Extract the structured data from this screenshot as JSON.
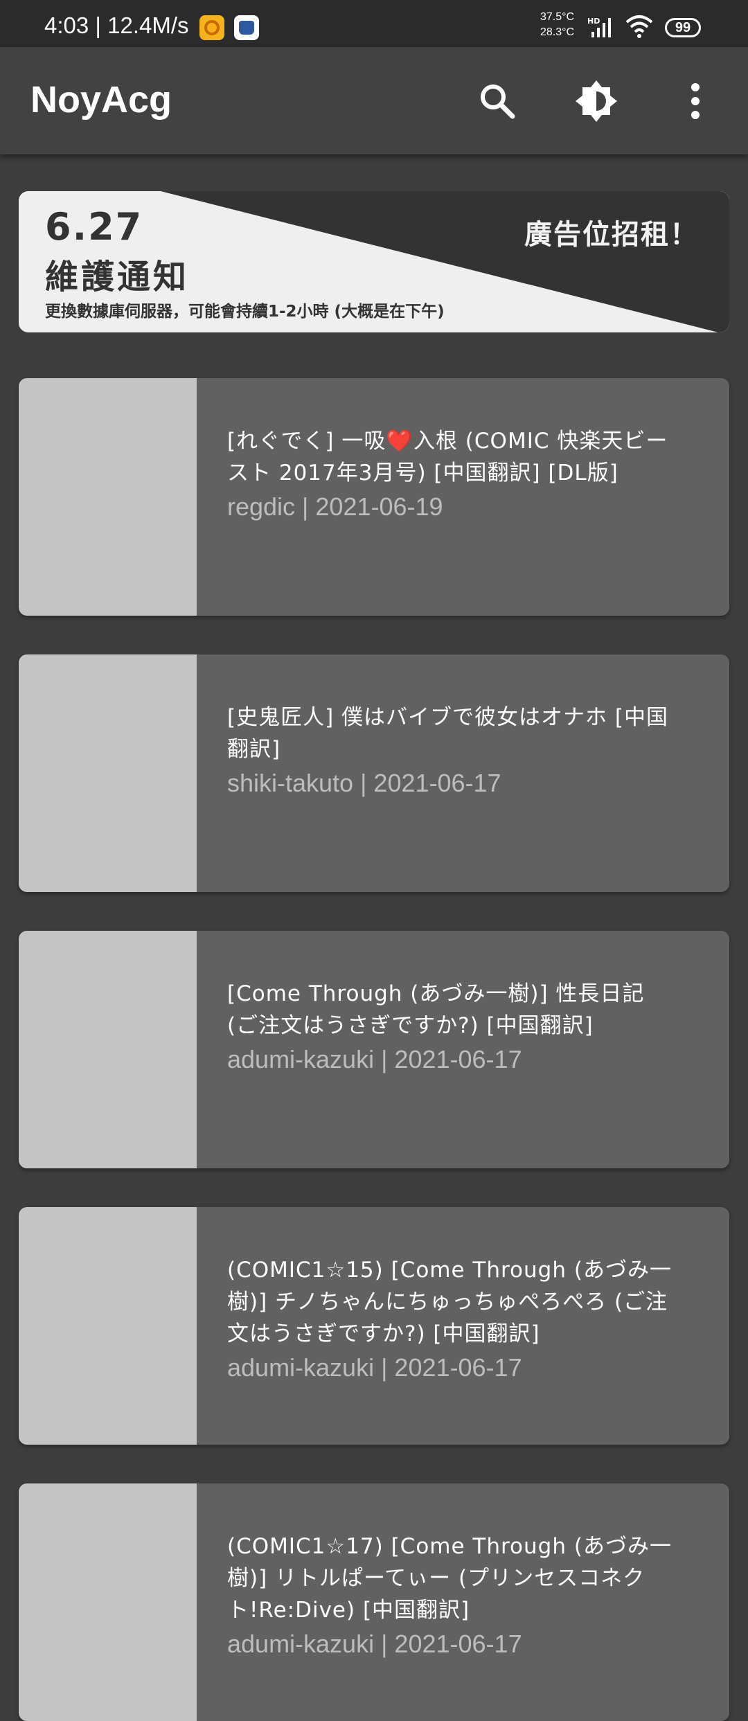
{
  "status_bar": {
    "time_speed": "4:03 | 12.4M/s",
    "temp_top": "37.5°C",
    "temp_bottom": "28.3°C",
    "hd": "HD",
    "battery": "99"
  },
  "app_bar": {
    "title": "NoyAcg",
    "icons": [
      "search-icon",
      "brightness-icon",
      "more-vert-icon"
    ]
  },
  "banner": {
    "date": "6.27",
    "title": "維護通知",
    "subtitle": "更換數據庫伺服器，可能會持續1-2小時 (大概是在下午)",
    "ad_text": "廣告位招租！"
  },
  "items": [
    {
      "title": "[れぐでく] 一吸❤️入根 (COMIC 快楽天ビースト 2017年3月号) [中国翻訳] [DL版]",
      "meta": "regdic | 2021-06-19"
    },
    {
      "title": "[史鬼匠人] 僕はバイブで彼女はオナホ [中国翻訳]",
      "meta": "shiki-takuto | 2021-06-17"
    },
    {
      "title": "[Come Through (あづみ一樹)] 性長日記 (ご注文はうさぎですか?) [中国翻訳]",
      "meta": "adumi-kazuki | 2021-06-17"
    },
    {
      "title": "(COMIC1☆15) [Come Through (あづみ一樹)] チノちゃんにちゅっちゅぺろぺろ (ご注文はうさぎですか?) [中国翻訳]",
      "meta": "adumi-kazuki | 2021-06-17"
    },
    {
      "title": "(COMIC1☆17) [Come Through (あづみ一樹)] リトルぱーてぃー (プリンセスコネクト!Re:Dive) [中国翻訳]",
      "meta": "adumi-kazuki | 2021-06-17"
    }
  ]
}
